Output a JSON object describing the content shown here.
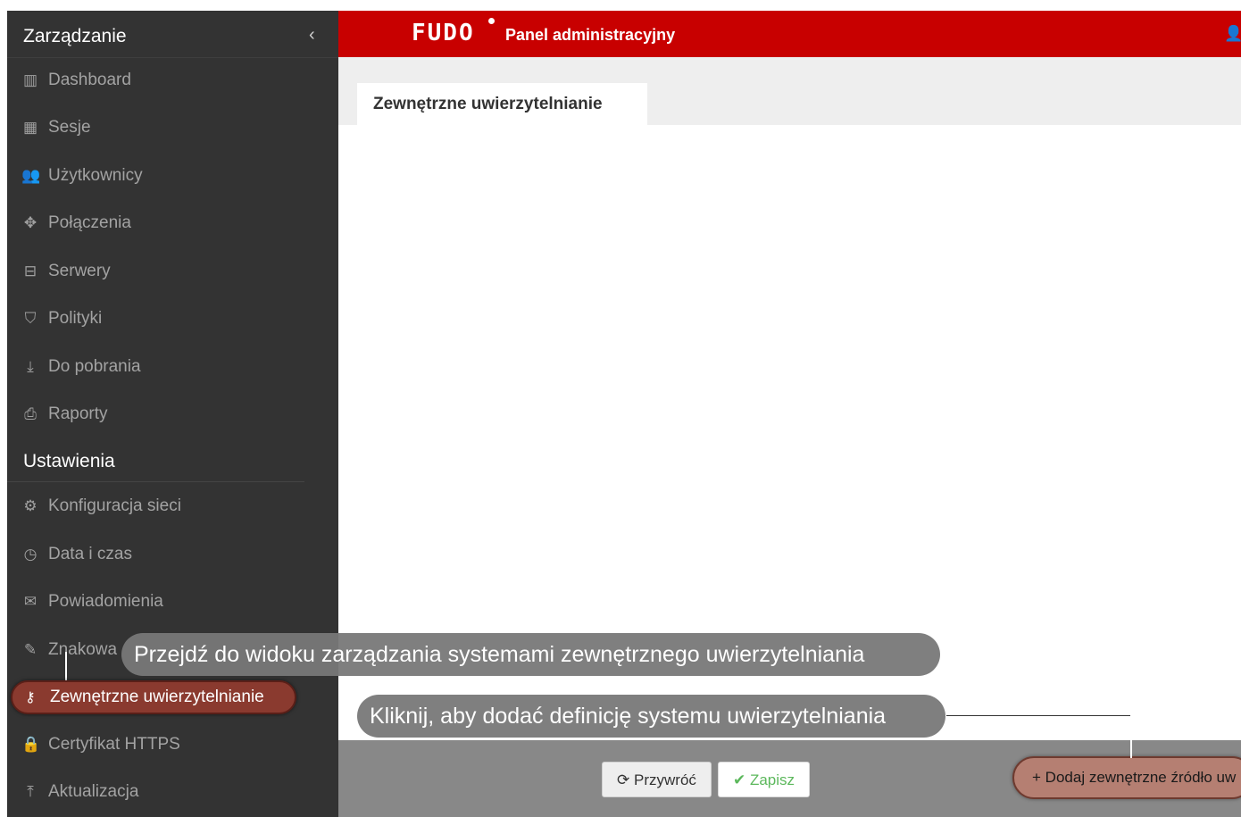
{
  "sidebar": {
    "title": "Zarządzanie",
    "collapse_glyph": "‹",
    "items": [
      {
        "label": "Dashboard",
        "icon": "bar-chart-icon",
        "glyph": "▥"
      },
      {
        "label": "Sesje",
        "icon": "film-icon",
        "glyph": "▦"
      },
      {
        "label": "Użytkownicy",
        "icon": "users-icon",
        "glyph": "👥"
      },
      {
        "label": "Połączenia",
        "icon": "move-arrows-icon",
        "glyph": "✥"
      },
      {
        "label": "Serwery",
        "icon": "server-icon",
        "glyph": "⊟"
      },
      {
        "label": "Polityki",
        "icon": "shield-icon",
        "glyph": "⛉"
      },
      {
        "label": "Do pobrania",
        "icon": "download-icon",
        "glyph": "⤓"
      },
      {
        "label": "Raporty",
        "icon": "print-icon",
        "glyph": "⎙"
      }
    ],
    "settings_title": "Ustawienia",
    "settings_items": [
      {
        "label": "Konfiguracja sieci",
        "icon": "cogs-icon",
        "glyph": "⚙"
      },
      {
        "label": "Data i czas",
        "icon": "clock-icon",
        "glyph": "◷"
      },
      {
        "label": "Powiadomienia",
        "icon": "envelope-icon",
        "glyph": "✉"
      },
      {
        "label": "Znakowa",
        "icon": "edit-icon",
        "glyph": "✎"
      },
      {
        "label": "Zewnętrzne uwierzytelnianie",
        "icon": "key-icon",
        "glyph": "⚷",
        "active": true
      },
      {
        "label": "Certyfikat HTTPS",
        "icon": "lock-icon",
        "glyph": "🔒"
      },
      {
        "label": "Aktualizacja",
        "icon": "upload-icon",
        "glyph": "⤒"
      }
    ]
  },
  "topbar": {
    "logo": "FUDO",
    "title": "Panel administracyjny",
    "user_glyph": "👤"
  },
  "main": {
    "tab_label": "Zewnętrzne uwierzytelnianie"
  },
  "footer": {
    "restore_label": "Przywróć",
    "restore_glyph": "⟳",
    "save_label": "Zapisz",
    "save_glyph": "✔",
    "add_label": "Dodaj zewnętrzne źródło uw",
    "add_glyph": "+"
  },
  "callouts": {
    "first": "Przejdź do widoku zarządzania systemami zewnętrznego uwierzytelniania",
    "second": "Kliknij, aby dodać definicję systemu uwierzytelniania"
  },
  "colors": {
    "topbar": "#c80000",
    "sidebar": "#333333",
    "highlight": "#8a3a2f",
    "save_check": "#5cb85c"
  }
}
